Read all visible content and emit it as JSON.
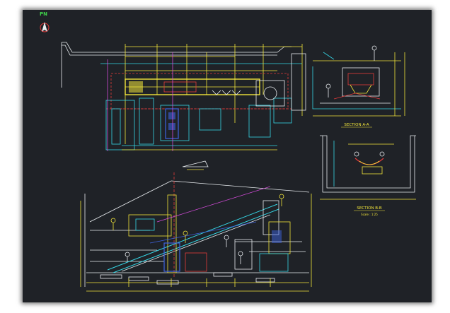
{
  "north_label": "PN",
  "sections": {
    "a": "SECTION  A-A",
    "b": "SECTION  B-B",
    "b_scale": "Scale : 1:25"
  },
  "colors": {
    "background": "#1f2227",
    "cyan": "#35d7e6",
    "yellow": "#f2e53a",
    "white": "#e9edf0",
    "red": "#e53b3b",
    "blue": "#3e63e0",
    "magenta": "#d24ad8",
    "green": "#3fd24a"
  }
}
